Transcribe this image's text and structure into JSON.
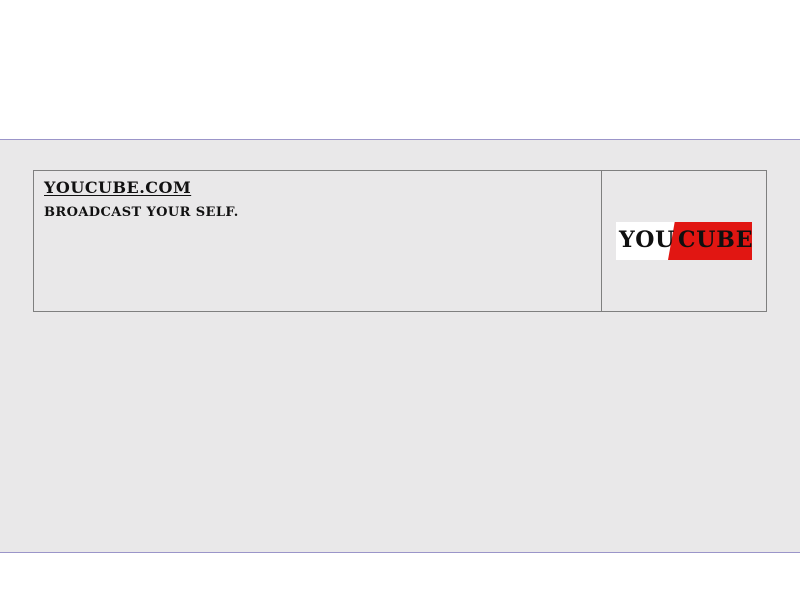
{
  "site": {
    "domain_text": "YOUCUBE.COM",
    "tagline": "BROADCAST YOUR SELF."
  },
  "logo": {
    "part_left": "YOU",
    "part_right": "CUBE",
    "accent_color": "#e11612"
  },
  "theme": {
    "band_background": "#e9e8e9",
    "band_border": "#9b95c9",
    "card_border": "#7f7f7f"
  }
}
